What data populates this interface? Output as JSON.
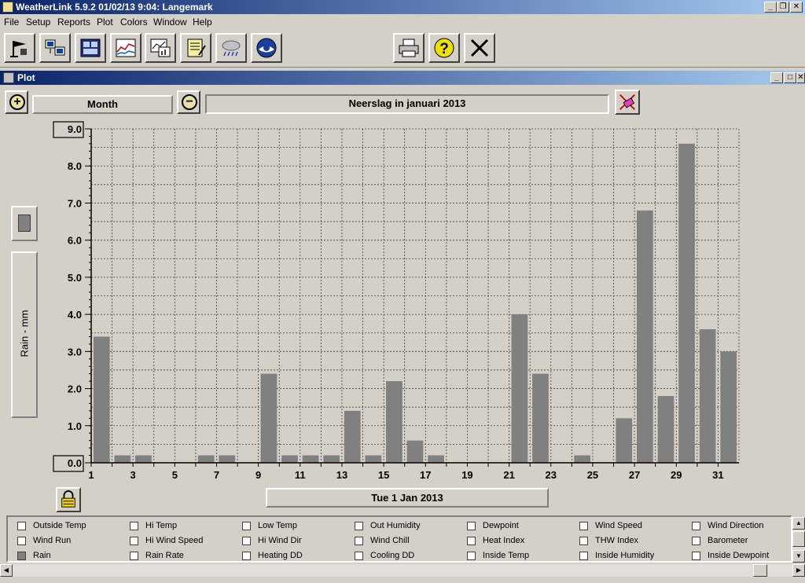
{
  "app": {
    "title": "WeatherLink 5.9.2  01/02/13  9:04: Langemark",
    "menu": [
      "File",
      "Setup",
      "Reports",
      "Plot",
      "Colors",
      "Window",
      "Help"
    ]
  },
  "toolbar": {
    "left_tools": [
      "station-icon",
      "download-icon",
      "bulletin-icon",
      "strip-chart-icon",
      "plot-icon",
      "notes-icon",
      "weather-icon",
      "noaa-icon"
    ],
    "right_tools": [
      "printer-icon",
      "help-icon",
      "close-icon"
    ]
  },
  "plot_window": {
    "title": "Plot",
    "period": "Month",
    "plot_title": "Neerslag in januari 2013",
    "date_label": "Tue 1 Jan 2013"
  },
  "chart_data": {
    "type": "bar",
    "ylabel": "Rain - mm",
    "ylim": [
      0,
      9
    ],
    "y_ticks": [
      "0.0",
      "1.0",
      "2.0",
      "3.0",
      "4.0",
      "5.0",
      "6.0",
      "7.0",
      "8.0",
      "9.0"
    ],
    "x_ticks": [
      1,
      3,
      5,
      7,
      9,
      11,
      13,
      15,
      17,
      19,
      21,
      23,
      25,
      27,
      29,
      31
    ],
    "categories": [
      1,
      2,
      3,
      4,
      5,
      6,
      7,
      8,
      9,
      10,
      11,
      12,
      13,
      14,
      15,
      16,
      17,
      18,
      19,
      20,
      21,
      22,
      23,
      24,
      25,
      26,
      27,
      28,
      29,
      30,
      31
    ],
    "values": [
      3.4,
      0.2,
      0.2,
      0,
      0,
      0.2,
      0.2,
      0,
      2.4,
      0.2,
      0.2,
      0.2,
      1.4,
      0.2,
      2.2,
      0.6,
      0.2,
      0,
      0,
      0,
      4.0,
      2.4,
      0,
      0.2,
      0,
      1.2,
      6.8,
      1.8,
      8.6,
      3.6,
      3.0
    ],
    "grid": true,
    "bar_color": "#808080"
  },
  "legend": {
    "items": [
      {
        "label": "Outside Temp",
        "checked": false
      },
      {
        "label": "Hi Temp",
        "checked": false
      },
      {
        "label": "Low Temp",
        "checked": false
      },
      {
        "label": "Out Humidity",
        "checked": false
      },
      {
        "label": "Dewpoint",
        "checked": false
      },
      {
        "label": "Wind Speed",
        "checked": false
      },
      {
        "label": "Wind Direction",
        "checked": false
      },
      {
        "label": "Wind Run",
        "checked": false
      },
      {
        "label": "Hi Wind Speed",
        "checked": false
      },
      {
        "label": "Hi Wind Dir",
        "checked": false
      },
      {
        "label": "Wind Chill",
        "checked": false
      },
      {
        "label": "Heat Index",
        "checked": false
      },
      {
        "label": "THW Index",
        "checked": false
      },
      {
        "label": "Barometer",
        "checked": false
      },
      {
        "label": "Rain",
        "checked": true
      },
      {
        "label": "Rain Rate",
        "checked": false
      },
      {
        "label": "Heating DD",
        "checked": false
      },
      {
        "label": "Cooling DD",
        "checked": false
      },
      {
        "label": "Inside Temp",
        "checked": false
      },
      {
        "label": "Inside Humidity",
        "checked": false
      },
      {
        "label": "Inside Dewpoint",
        "checked": false
      }
    ]
  }
}
